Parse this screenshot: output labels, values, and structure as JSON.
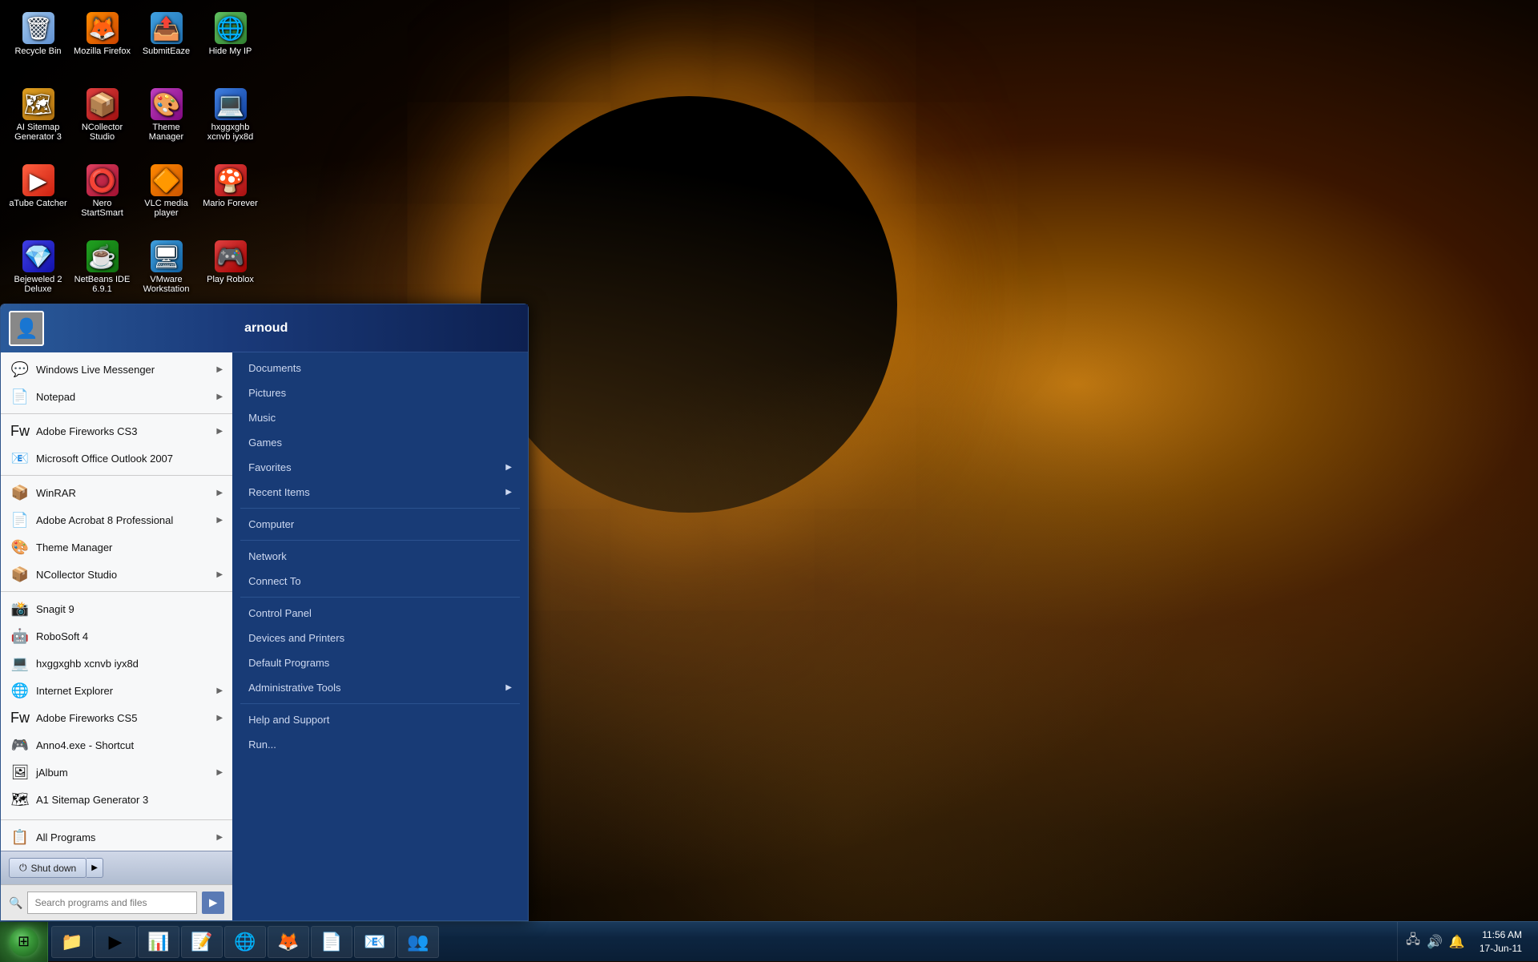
{
  "desktop": {
    "icons": [
      {
        "id": "recycle-bin",
        "label": "Recycle Bin",
        "icon": "🗑",
        "color": "ic-recycle"
      },
      {
        "id": "mozilla-firefox",
        "label": "Mozilla Firefox",
        "icon": "🦊",
        "color": "ic-firefox"
      },
      {
        "id": "submiteaze",
        "label": "SubmitEaze",
        "icon": "📤",
        "color": "ic-submit"
      },
      {
        "id": "hide-my-ip",
        "label": "Hide My IP",
        "icon": "🌐",
        "color": "ic-hideip"
      },
      {
        "id": "ai-sitemap",
        "label": "AI Sitemap Generator 3",
        "icon": "🗺",
        "color": "ic-sitemap"
      },
      {
        "id": "ncollector-studio",
        "label": "NCollector Studio",
        "icon": "📦",
        "color": "ic-ncollector"
      },
      {
        "id": "theme-manager",
        "label": "Theme Manager",
        "icon": "🎨",
        "color": "ic-theme"
      },
      {
        "id": "hxgg-xcnvb",
        "label": "hxggxghb xcnvb iyx8d",
        "icon": "💻",
        "color": "ic-hxgg"
      },
      {
        "id": "atube-catcher",
        "label": "aTube Catcher",
        "icon": "▶",
        "color": "ic-atube"
      },
      {
        "id": "nero-startsmart",
        "label": "Nero StartSmart",
        "icon": "⭕",
        "color": "ic-nero"
      },
      {
        "id": "vlc-media-player",
        "label": "VLC media player",
        "icon": "🔶",
        "color": "ic-vlc"
      },
      {
        "id": "mario-forever",
        "label": "Mario Forever",
        "icon": "🍄",
        "color": "ic-mario"
      },
      {
        "id": "bejeweled",
        "label": "Bejeweled 2 Deluxe",
        "icon": "💎",
        "color": "ic-bejeweled"
      },
      {
        "id": "netbeans-ide",
        "label": "NetBeans IDE 6.9.1",
        "icon": "☕",
        "color": "ic-netbeans"
      },
      {
        "id": "vmware",
        "label": "VMware Workstation",
        "icon": "🖥",
        "color": "ic-vmware"
      },
      {
        "id": "play-roblox",
        "label": "Play Roblox",
        "icon": "🎮",
        "color": "ic-roblox"
      }
    ]
  },
  "taskbar": {
    "items": [
      {
        "id": "start",
        "label": "Start",
        "icon": "⊞"
      },
      {
        "id": "explorer",
        "label": "Windows Explorer",
        "icon": "📁"
      },
      {
        "id": "wmp",
        "label": "Windows Media Player",
        "icon": "▶"
      },
      {
        "id": "excel",
        "label": "Microsoft Excel",
        "icon": "📊"
      },
      {
        "id": "word",
        "label": "Microsoft Word",
        "icon": "📝"
      },
      {
        "id": "dreamweaver",
        "label": "Adobe Dreamweaver",
        "icon": "🌐"
      },
      {
        "id": "firefox-task",
        "label": "Mozilla Firefox",
        "icon": "🦊"
      },
      {
        "id": "notepad-task",
        "label": "Notepad",
        "icon": "📄"
      },
      {
        "id": "outlook-task",
        "label": "Outlook",
        "icon": "📧"
      },
      {
        "id": "contacts",
        "label": "Windows Contacts",
        "icon": "👥"
      }
    ],
    "tray": {
      "icons": [
        "🔔",
        "🔊",
        "📶",
        "🖧"
      ],
      "time": "11:56 AM",
      "date": "17-Jun-11"
    }
  },
  "start_menu": {
    "user": {
      "name": "arnoud",
      "avatar": "👤"
    },
    "programs": [
      {
        "id": "wlm",
        "label": "Windows Live Messenger",
        "icon": "💬",
        "has_arrow": true
      },
      {
        "id": "notepad",
        "label": "Notepad",
        "icon": "📄",
        "has_arrow": true
      },
      {
        "id": "adobe-fireworks-cs3",
        "label": "Adobe Fireworks CS3",
        "icon": "Fw",
        "has_arrow": true
      },
      {
        "id": "ms-outlook",
        "label": "Microsoft Office Outlook 2007",
        "icon": "📧",
        "has_arrow": false
      },
      {
        "id": "winrar",
        "label": "WinRAR",
        "icon": "📦",
        "has_arrow": true
      },
      {
        "id": "adobe-acrobat",
        "label": "Adobe Acrobat 8 Professional",
        "icon": "📄",
        "has_arrow": true
      },
      {
        "id": "theme-mgr",
        "label": "Theme Manager",
        "icon": "🎨",
        "has_arrow": false
      },
      {
        "id": "ncollector",
        "label": "NCollector Studio",
        "icon": "📦",
        "has_arrow": true
      },
      {
        "id": "snagit",
        "label": "Snagit 9",
        "icon": "📸",
        "has_arrow": false
      },
      {
        "id": "robosoft",
        "label": "RoboSoft 4",
        "icon": "🤖",
        "has_arrow": false
      },
      {
        "id": "hxgg2",
        "label": "hxggxghb xcnvb iyx8d",
        "icon": "💻",
        "has_arrow": false
      },
      {
        "id": "ie",
        "label": "Internet Explorer",
        "icon": "🌐",
        "has_arrow": true
      },
      {
        "id": "adobe-fw5",
        "label": "Adobe Fireworks CS5",
        "icon": "Fw",
        "has_arrow": true
      },
      {
        "id": "anno4",
        "label": "Anno4.exe - Shortcut",
        "icon": "🎮",
        "has_arrow": false
      },
      {
        "id": "jalbum",
        "label": "jAlbum",
        "icon": "🖼",
        "has_arrow": true
      },
      {
        "id": "a1-sitemap",
        "label": "A1 Sitemap Generator 3",
        "icon": "🗺",
        "has_arrow": false
      }
    ],
    "all_programs_label": "All Programs",
    "search_placeholder": "Search programs and files",
    "shutdown_label": "Shut down",
    "right_links": [
      {
        "id": "documents",
        "label": "Documents",
        "has_arrow": false
      },
      {
        "id": "pictures",
        "label": "Pictures",
        "has_arrow": false
      },
      {
        "id": "music",
        "label": "Music",
        "has_arrow": false
      },
      {
        "id": "games",
        "label": "Games",
        "has_arrow": false
      },
      {
        "id": "favorites",
        "label": "Favorites",
        "has_arrow": true
      },
      {
        "id": "recent-items",
        "label": "Recent Items",
        "has_arrow": true
      },
      {
        "id": "computer",
        "label": "Computer",
        "has_arrow": false
      },
      {
        "id": "network",
        "label": "Network",
        "has_arrow": false
      },
      {
        "id": "connect-to",
        "label": "Connect To",
        "has_arrow": false
      },
      {
        "id": "control-panel",
        "label": "Control Panel",
        "has_arrow": false
      },
      {
        "id": "devices-printers",
        "label": "Devices and Printers",
        "has_arrow": false
      },
      {
        "id": "default-programs",
        "label": "Default Programs",
        "has_arrow": false
      },
      {
        "id": "admin-tools",
        "label": "Administrative Tools",
        "has_arrow": true
      },
      {
        "id": "help-support",
        "label": "Help and Support",
        "has_arrow": false
      },
      {
        "id": "run",
        "label": "Run...",
        "has_arrow": false
      }
    ]
  }
}
